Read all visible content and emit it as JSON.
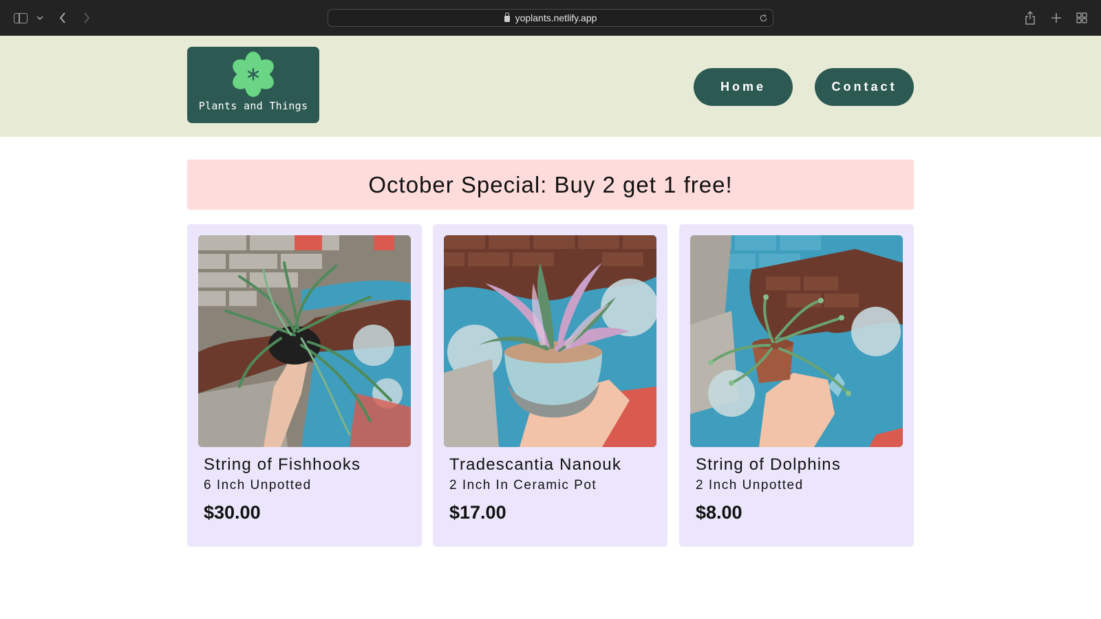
{
  "browser": {
    "url": "yoplants.netlify.app",
    "icons": [
      "sidebar-icon",
      "chevron-down-icon",
      "back-arrow-icon",
      "forward-arrow-icon",
      "lock-icon",
      "reload-icon",
      "share-icon",
      "plus-icon",
      "tab-grid-icon"
    ]
  },
  "header": {
    "logo_text": "Plants and Things",
    "logo_icon": "flower-icon",
    "nav": [
      {
        "label": "Home"
      },
      {
        "label": "Contact"
      }
    ]
  },
  "banner": {
    "text": "October Special: Buy 2 get 1 free!"
  },
  "products": [
    {
      "name": "String of Fishhooks",
      "size": "6 Inch Unpotted",
      "price": "$30.00"
    },
    {
      "name": "Tradescantia Nanouk",
      "size": "2 Inch In Ceramic Pot",
      "price": "$17.00"
    },
    {
      "name": "String of Dolphins",
      "size": "2 Inch Unpotted",
      "price": "$8.00"
    }
  ],
  "colors": {
    "header_bg": "#e7ebd5",
    "brand_green": "#2c5a52",
    "banner_bg": "#fddcdb",
    "card_bg": "#ebe6fb",
    "logo_flower": "#6fe08a"
  }
}
